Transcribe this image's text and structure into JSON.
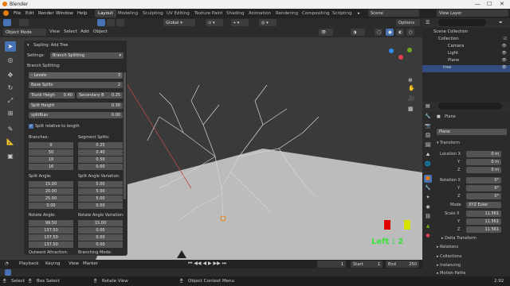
{
  "window": {
    "title": "Blender",
    "minimize": "—",
    "maximize": "☐",
    "close": "✕"
  },
  "menu": [
    "File",
    "Edit",
    "Render",
    "Window",
    "Help"
  ],
  "workspaces": [
    "Layout",
    "Modeling",
    "Sculpting",
    "UV Editing",
    "Texture Paint",
    "Shading",
    "Animation",
    "Rendering",
    "Compositing",
    "Scripting"
  ],
  "scene": {
    "name": "Scene",
    "view_layer": "View Layer"
  },
  "toolrow": {
    "transform": "Global",
    "options": "Options"
  },
  "header3d": {
    "mode": "Object Mode",
    "items": [
      "View",
      "Select",
      "Add",
      "Object"
    ]
  },
  "panel": {
    "title": "Sapling: Add Tree",
    "settings_label": "Settings:",
    "settings_value": "Branch Splitting",
    "section": "Branch Splitting:",
    "levels_label": "Levels",
    "levels_value": "3",
    "base_splits_label": "Base Splits",
    "base_splits_value": "2",
    "trunk_height_label": "Trunk Heigh",
    "trunk_height_value": "0.40",
    "secondary_label": "Secondary B",
    "secondary_value": "0.25",
    "split_height_label": "Split Height",
    "split_height_value": "0.30",
    "split_bias_label": "splitBias",
    "split_bias_value": "0.00",
    "split_relative_label": "Split relative to length",
    "branches_label": "Branches:",
    "branches": [
      "0",
      "50",
      "10",
      "16"
    ],
    "segment_splits_label": "Segment Splits:",
    "segment_splits": [
      "0.25",
      "0.40",
      "0.50",
      "0.00"
    ],
    "split_angle_label": "Split Angle:",
    "split_angle": [
      "15.00",
      "20.00",
      "25.00",
      "0.00"
    ],
    "split_angle_var_label": "Split Angle Variation:",
    "split_angle_var": [
      "5.00",
      "5.00",
      "5.00",
      "0.00"
    ],
    "rotate_angle_label": "Rotate Angle:",
    "rotate_angle": [
      "99.50",
      "137.50",
      "137.50",
      "137.50"
    ],
    "rotate_angle_var_label": "Rotate Angle Variation:",
    "rotate_angle_var": [
      "15.00",
      "0.00",
      "0.00",
      "0.00"
    ],
    "outward_label": "Outward Attraction:",
    "branching_mode_label": "Branching Mode:"
  },
  "viewport_text": "Left : 2",
  "outliner": {
    "header": "Scene Collection",
    "rows": [
      "Collection",
      "Camera",
      "Light",
      "Plane",
      "tree"
    ]
  },
  "props": {
    "object_name": "Plane",
    "data_name": "Plane",
    "transform_label": "Transform",
    "location_label": "Location X",
    "location": [
      "0 m",
      "0 m",
      "0 m"
    ],
    "rotation_label": "Rotation X",
    "rotation": [
      "0°",
      "0°",
      "0°"
    ],
    "mode_label": "Mode",
    "mode_value": "XYZ Euler",
    "scale_label": "Scale X",
    "scale": [
      "11.561",
      "11.561",
      "11.561"
    ],
    "axis_y": "Y",
    "axis_z": "Z",
    "delta_transform": "Delta Transform",
    "relations": "Relations",
    "collections": "Collections",
    "instancing": "Instancing",
    "motion_paths": "Motion Paths"
  },
  "timeline": {
    "items": [
      "Playback",
      "Keying",
      "View",
      "Marker"
    ],
    "current": "1",
    "start_label": "Start",
    "start": "1",
    "end_label": "End",
    "end": "250"
  },
  "status": {
    "select": "Select",
    "box_select": "Box Select",
    "rotate_view": "Rotate View",
    "context_menu": "Object Context Menu",
    "version": "2.92"
  },
  "colors": {
    "accent": "#4772b3",
    "viewport_bg": "#3a3a3a",
    "floor": "#bcbcbc",
    "overlay_text": "#3ce23c"
  }
}
